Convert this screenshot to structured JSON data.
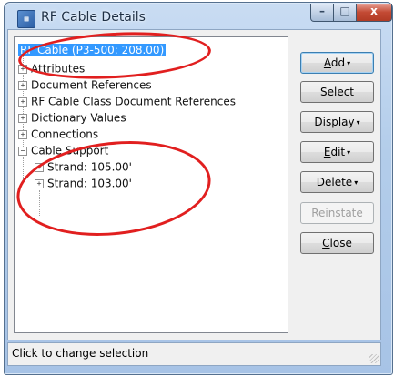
{
  "window": {
    "title": "RF Cable Details",
    "controls": {
      "minimize": "–",
      "maximize": "□",
      "close": "x"
    }
  },
  "tree": {
    "root_label": "RF Cable (P3-500: 208.00)",
    "children": [
      {
        "label": "Attributes",
        "toggle": "+"
      },
      {
        "label": "Document References",
        "toggle": "+"
      },
      {
        "label": "RF Cable Class Document References",
        "toggle": "+"
      },
      {
        "label": "Dictionary Values",
        "toggle": "+"
      },
      {
        "label": "Connections",
        "toggle": "+"
      },
      {
        "label": "Cable Support",
        "toggle": "−"
      }
    ],
    "cable_support_children": [
      {
        "label": "Strand: 105.00'",
        "toggle": "+"
      },
      {
        "label": "Strand: 103.00'",
        "toggle": "+"
      }
    ]
  },
  "buttons": {
    "add": {
      "label": "Add",
      "mnemonic": "A",
      "rest": "dd"
    },
    "select": {
      "label": "Select"
    },
    "display": {
      "label": "Display",
      "mnemonic": "D",
      "rest": "isplay"
    },
    "edit": {
      "label": "Edit",
      "mnemonic": "E",
      "rest": "dit"
    },
    "delete": {
      "label": "Delete"
    },
    "reinstate": {
      "label": "Reinstate",
      "disabled": true
    },
    "close": {
      "label": "Close",
      "mnemonic": "C",
      "rest": "lose"
    },
    "dropdown_caret": "▾"
  },
  "status": {
    "text": "Click to change selection"
  },
  "colors": {
    "selection": "#3399ff",
    "annotation_ring": "#e11f1f",
    "close_button": "#c34a34"
  }
}
